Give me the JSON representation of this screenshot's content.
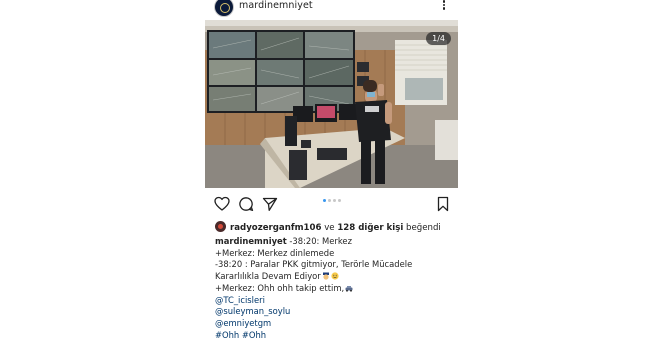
{
  "post": {
    "username": "mardinemniyet",
    "image_counter": "1/4",
    "carousel": {
      "total": 4,
      "active": 0
    }
  },
  "icons": {
    "avatar": "police-logo-avatar",
    "more": "more-options-icon",
    "like": "heart-icon",
    "comment": "comment-icon",
    "share": "share-icon",
    "save": "bookmark-icon"
  },
  "likes": {
    "user": "radyozerganfm106",
    "connector": " ve ",
    "others": "128 diğer kişi",
    "suffix": " beğendi"
  },
  "caption": {
    "author": "mardinemniyet",
    "line1_rest": " -38:20: Merkez",
    "line2": "+Merkez: Merkez dinlemede",
    "line3": "-38:20 : Paralar PKK gitmiyor, Terörle Mücadele",
    "line4": "Kararlılıkla Devam Ediyor",
    "line5": "+Merkez: Ohh ohh takip ettim,",
    "mention1": "@TC_icisleri",
    "mention2": "@suleyman_soylu",
    "mention3": "@emniyetgm",
    "hashtags": "#Ohh #Ohh"
  },
  "colors": {
    "link": "#00376b",
    "dot_active": "#3897f0",
    "dot_inactive": "#c8c8c8"
  }
}
